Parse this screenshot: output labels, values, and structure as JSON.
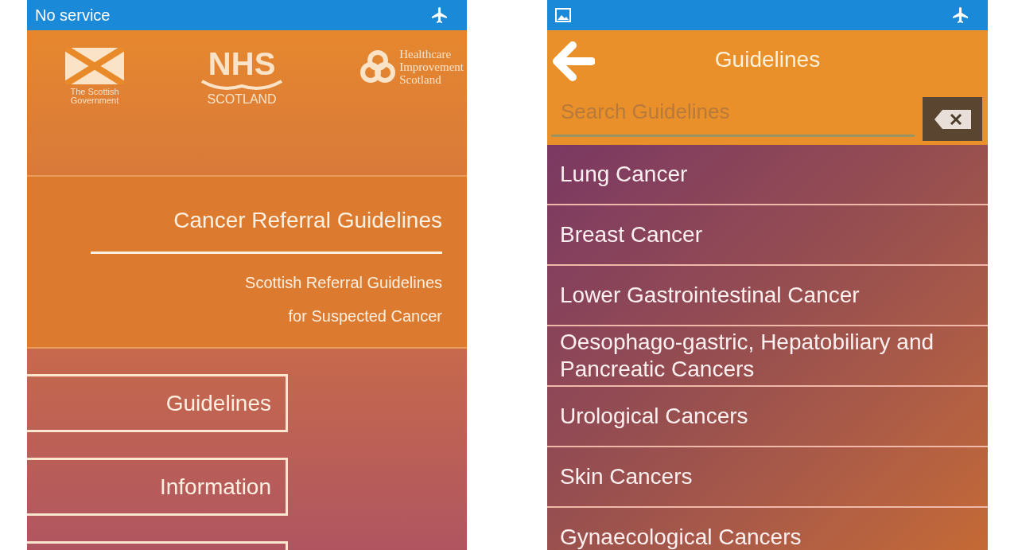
{
  "phones": [
    {
      "kind": "home",
      "status_bar": {
        "carrier": "No service",
        "image_notification": false,
        "airplane_mode": true
      },
      "logos": [
        {
          "kind": "saltire",
          "lines": [
            "The Scottish",
            "Government"
          ]
        },
        {
          "kind": "nhs",
          "lines": [
            "NHS",
            "SCOTLAND"
          ]
        },
        {
          "kind": "knot",
          "lines": [
            "Healthcare",
            "Improvement",
            "Scotland"
          ]
        }
      ],
      "title": "Cancer Referral Guidelines",
      "subtitle": [
        "Scottish Referral Guidelines",
        "for Suspected Cancer"
      ],
      "buttons": [
        {
          "label": "Guidelines"
        },
        {
          "label": "Information"
        }
      ],
      "buttons_continue_below": true
    },
    {
      "kind": "list",
      "status_bar": {
        "image_notification": true,
        "airplane_mode": true
      },
      "title": "Guidelines",
      "search": {
        "placeholder": "Search Guidelines"
      },
      "items": [
        {
          "label": "Lung Cancer"
        },
        {
          "label": "Breast Cancer"
        },
        {
          "label": "Lower Gastrointestinal Cancer"
        },
        {
          "label": "Oesophago-gastric, Hepatobiliary and Pancreatic Cancers"
        },
        {
          "label": "Urological Cancers"
        },
        {
          "label": "Skin Cancers"
        },
        {
          "label": "Gynaecological Cancers"
        }
      ]
    }
  ]
}
